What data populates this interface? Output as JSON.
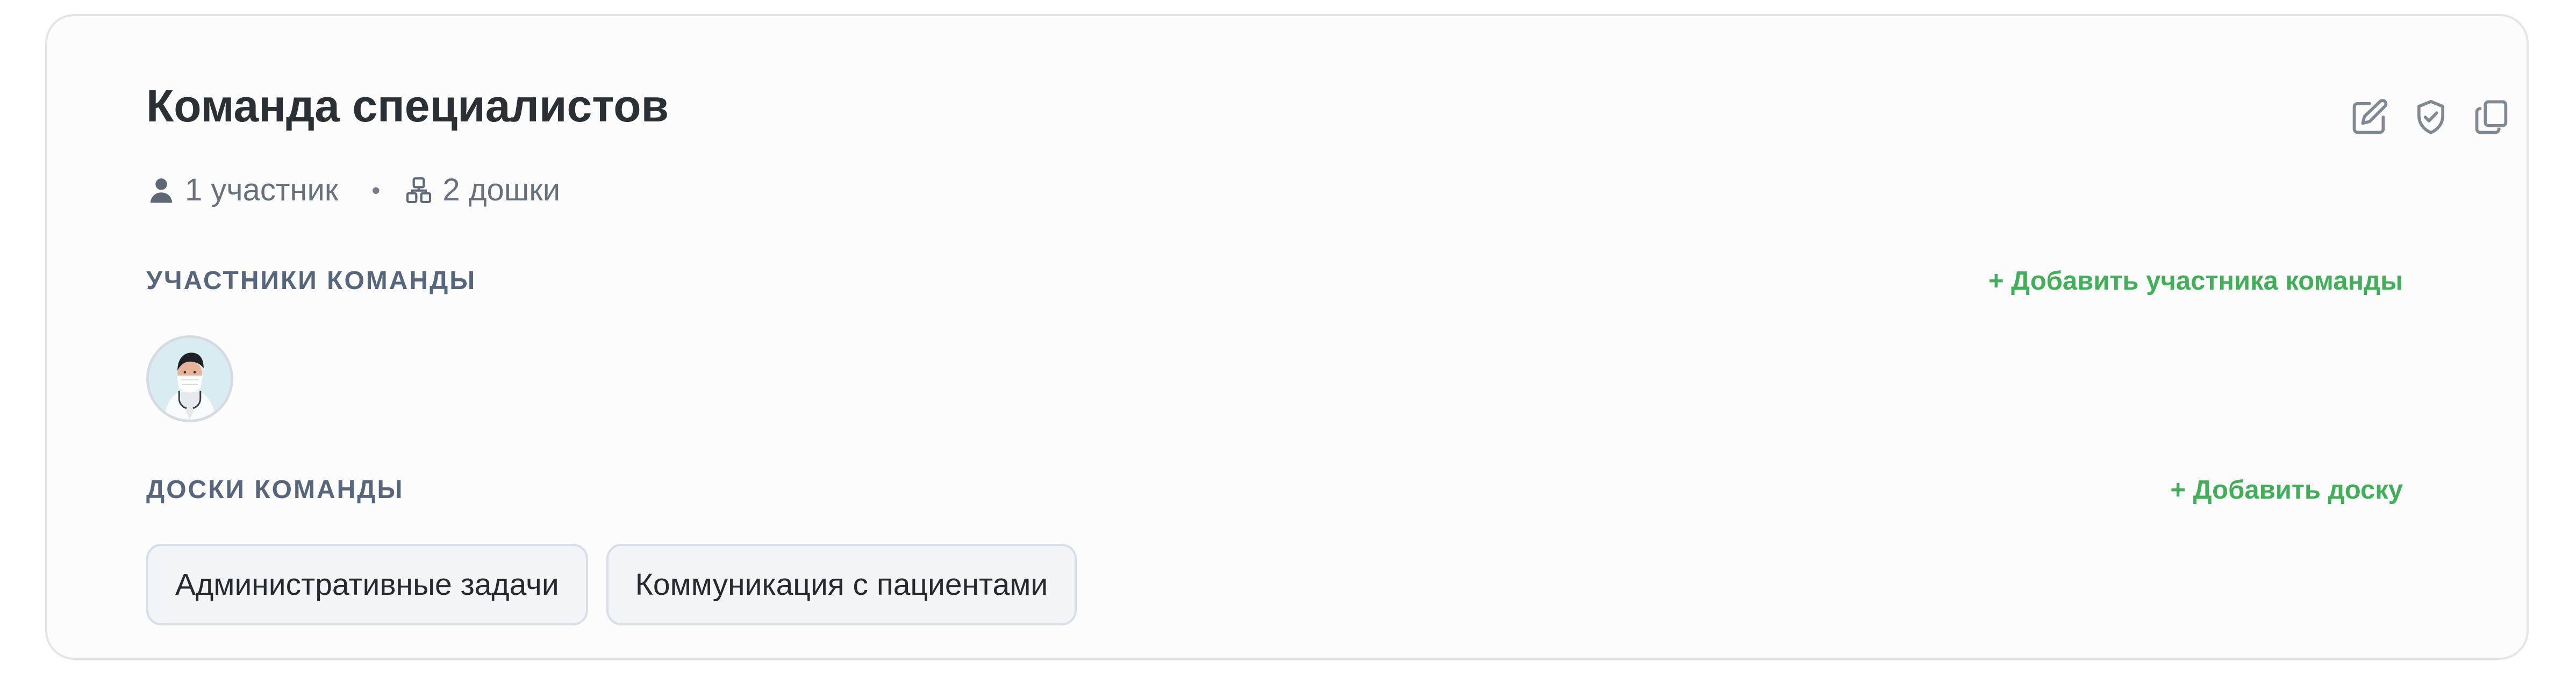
{
  "team": {
    "title": "Команда специалистов",
    "members_count": "1 участник",
    "separator": "•",
    "boards_count": "2 дошки"
  },
  "actions": [
    {
      "name": "edit-icon"
    },
    {
      "name": "shield-check-icon"
    },
    {
      "name": "copy-icon"
    }
  ],
  "sections": {
    "members": {
      "title": "УЧАСТНИКИ КОМАНДЫ",
      "add_label": "+ Добавить участника команды"
    },
    "boards": {
      "title": "ДОСКИ КОМАНДЫ",
      "add_label": "+ Добавить доску"
    }
  },
  "members": [
    {
      "avatar": "doctor-avatar"
    }
  ],
  "boards": [
    "Административные задачи",
    "Коммуникация с пациентами"
  ],
  "colors": {
    "accent": "#3faf58",
    "title": "#2b3035",
    "muted": "#68707b",
    "section": "#56677d",
    "chip_background": "#f2f4f8",
    "chip_border": "#d8dee8"
  }
}
